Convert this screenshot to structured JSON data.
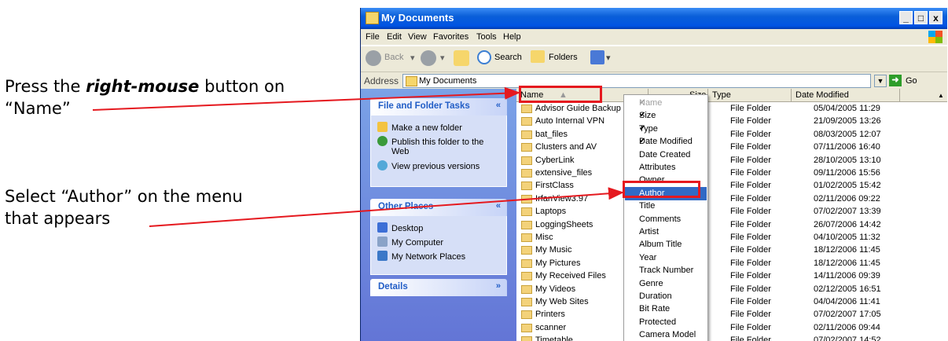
{
  "annotations": {
    "step1_pre": "Press the ",
    "step1_em": "right-mouse",
    "step1_post": " button on",
    "step1_line2": "“Name”",
    "step2_line1": "Select “Author” on the menu",
    "step2_line2": "that appears"
  },
  "window": {
    "title": "My Documents",
    "controls": {
      "minimize": "_",
      "maximize": "□",
      "close": "x"
    },
    "menu": [
      "File",
      "Edit",
      "View",
      "Favorites",
      "Tools",
      "Help"
    ],
    "toolbar": {
      "back": "Back",
      "search": "Search",
      "folders": "Folders"
    },
    "address": {
      "label": "Address",
      "value": "My Documents",
      "go": "Go"
    }
  },
  "left_panels": {
    "tasks": {
      "title": "File and Folder Tasks",
      "items": [
        "Make a new folder",
        "Publish this folder to the",
        "Web",
        "View previous versions"
      ]
    },
    "places": {
      "title": "Other Places",
      "items": [
        "Desktop",
        "My Computer",
        "My Network Places"
      ]
    },
    "details": {
      "title": "Details"
    }
  },
  "columns": {
    "name": "Name",
    "size": "Size",
    "type": "Type",
    "date": "Date Modified"
  },
  "files": [
    {
      "name": "Advisor Guide Backup",
      "type": "File Folder",
      "date": "05/04/2005 11:29"
    },
    {
      "name": "Auto Internal VPN",
      "type": "File Folder",
      "date": "21/09/2005 13:26"
    },
    {
      "name": "bat_files",
      "type": "File Folder",
      "date": "08/03/2005 12:07"
    },
    {
      "name": "Clusters and AV",
      "type": "File Folder",
      "date": "07/11/2006 16:40"
    },
    {
      "name": "CyberLink",
      "type": "File Folder",
      "date": "28/10/2005 13:10"
    },
    {
      "name": "extensive_files",
      "type": "File Folder",
      "date": "09/11/2006 15:56"
    },
    {
      "name": "FirstClass",
      "type": "File Folder",
      "date": "01/02/2005 15:42"
    },
    {
      "name": "IrfanView3.97",
      "type": "File Folder",
      "date": "02/11/2006 09:22"
    },
    {
      "name": "Laptops",
      "type": "File Folder",
      "date": "07/02/2007 13:39"
    },
    {
      "name": "LoggingSheets",
      "type": "File Folder",
      "date": "26/07/2006 14:42"
    },
    {
      "name": "Misc",
      "type": "File Folder",
      "date": "04/10/2005 11:32"
    },
    {
      "name": "My Music",
      "type": "File Folder",
      "date": "18/12/2006 11:45"
    },
    {
      "name": "My Pictures",
      "type": "File Folder",
      "date": "18/12/2006 11:45"
    },
    {
      "name": "My Received Files",
      "type": "File Folder",
      "date": "14/11/2006 09:39"
    },
    {
      "name": "My Videos",
      "type": "File Folder",
      "date": "02/12/2005 16:51"
    },
    {
      "name": "My Web Sites",
      "type": "File Folder",
      "date": "04/04/2006 11:41"
    },
    {
      "name": "Printers",
      "type": "File Folder",
      "date": "07/02/2007 17:05"
    },
    {
      "name": "scanner",
      "type": "File Folder",
      "date": "02/11/2006 09:44"
    },
    {
      "name": "Timetable",
      "type": "File Folder",
      "date": "07/02/2007 14:52"
    }
  ],
  "context_menu": [
    {
      "label": "Name",
      "checked": true,
      "disabled": true
    },
    {
      "label": "Size",
      "checked": true
    },
    {
      "label": "Type",
      "checked": true
    },
    {
      "label": "Date Modified",
      "checked": true
    },
    {
      "label": "Date Created"
    },
    {
      "label": "Attributes"
    },
    {
      "label": "Owner"
    },
    {
      "label": "Author",
      "highlighted": true
    },
    {
      "label": "Title"
    },
    {
      "label": "Comments"
    },
    {
      "label": "Artist"
    },
    {
      "label": "Album Title"
    },
    {
      "label": "Year"
    },
    {
      "label": "Track Number"
    },
    {
      "label": "Genre"
    },
    {
      "label": "Duration"
    },
    {
      "label": "Bit Rate"
    },
    {
      "label": "Protected"
    },
    {
      "label": "Camera Model"
    }
  ],
  "colors": {
    "highlight_box": "#e5191f",
    "menu_selection": "#316ac5",
    "titlebar": "#0054e3"
  }
}
